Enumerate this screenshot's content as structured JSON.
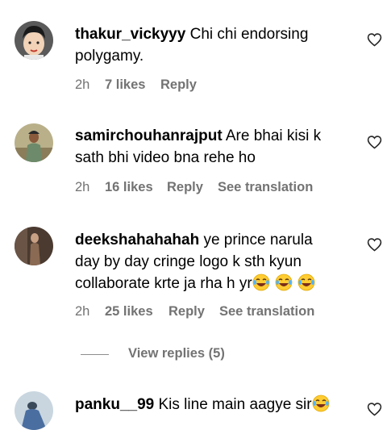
{
  "comments": [
    {
      "username": "thakur_vickyyy",
      "text": " Chi chi endorsing polygamy.",
      "time": "2h",
      "likes": "7 likes",
      "reply": "Reply",
      "translation": "",
      "avatar": "cartoon-boy-avatar"
    },
    {
      "username": "samirchouhanrajput",
      "text": " Are bhai kisi k sath bhi video bna rehe ho",
      "time": "2h",
      "likes": "16 likes",
      "reply": "Reply",
      "translation": "See translation",
      "avatar": "man-outdoors-avatar"
    },
    {
      "username": "deekshahahahah",
      "text": " ye prince narula day by day cringe logo k sth kyun collaborate krte ja rha h yr",
      "emoji": [
        "😂",
        "😂",
        "😂"
      ],
      "time": "2h",
      "likes": "25 likes",
      "reply": "Reply",
      "translation": "See translation",
      "avatar": "person-indoor-avatar"
    },
    {
      "username": "panku__99",
      "text": " Kis line main aagye sir",
      "emoji": [
        "😂"
      ],
      "avatar": "person-blue-sky-avatar"
    }
  ],
  "view_replies": "View replies (5)"
}
